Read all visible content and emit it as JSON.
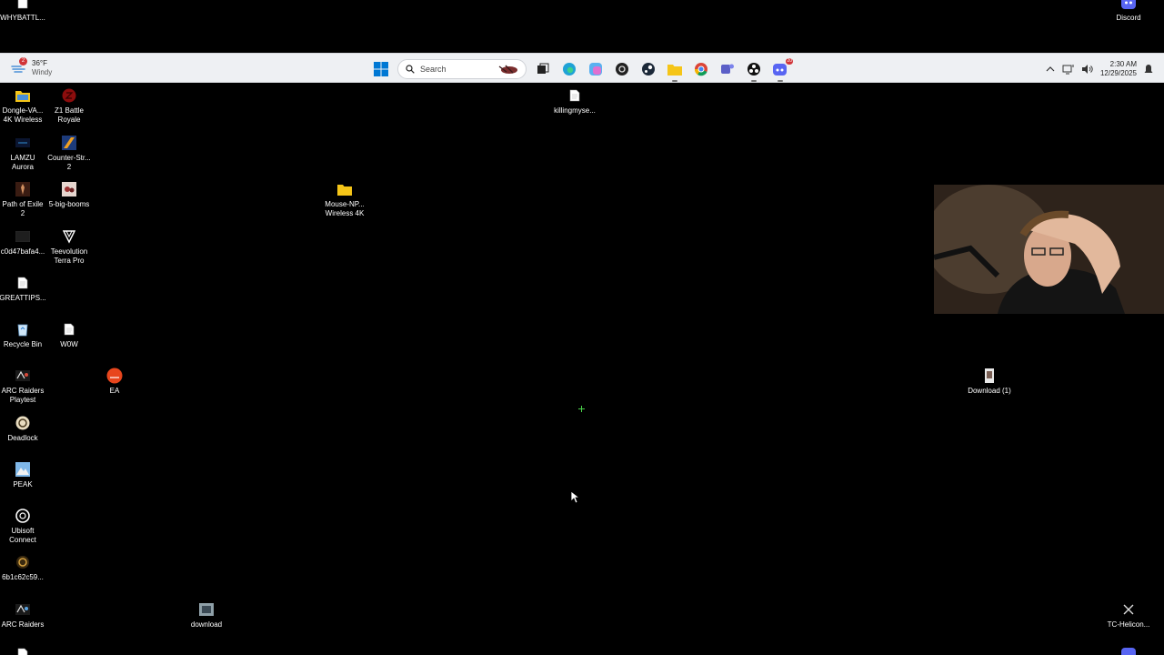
{
  "desktop": {
    "icons": [
      {
        "key": "whybattl",
        "label": "WHYBATTL..."
      },
      {
        "key": "discord_top",
        "label": "Discord"
      },
      {
        "key": "dongle",
        "label": "Dongle-VA...\n4K Wireless"
      },
      {
        "key": "z1",
        "label": "Z1 Battle\nRoyale"
      },
      {
        "key": "lamzu",
        "label": "LAMZU\nAurora"
      },
      {
        "key": "counterstrike",
        "label": "Counter-Str...\n2"
      },
      {
        "key": "poe",
        "label": "Path of Exile\n2"
      },
      {
        "key": "bigbooms",
        "label": "5-big-booms"
      },
      {
        "key": "c0d47",
        "label": "c0d47bafa4..."
      },
      {
        "key": "teevolution",
        "label": "Teevolution\nTerra Pro"
      },
      {
        "key": "greattips",
        "label": "GREATTIPS..."
      },
      {
        "key": "recyclebin",
        "label": "Recycle Bin"
      },
      {
        "key": "wow",
        "label": "W0W"
      },
      {
        "key": "arcplaytest",
        "label": "ARC Raiders\nPlaytest"
      },
      {
        "key": "ea",
        "label": "EA"
      },
      {
        "key": "deadlock",
        "label": "Deadlock"
      },
      {
        "key": "peak",
        "label": "PEAK"
      },
      {
        "key": "ubisoft",
        "label": "Ubisoft\nConnect"
      },
      {
        "key": "6b1c",
        "label": "6b1c62c59..."
      },
      {
        "key": "arcraiders",
        "label": "ARC Raiders"
      },
      {
        "key": "download",
        "label": "download"
      },
      {
        "key": "killing",
        "label": "killingmyse..."
      },
      {
        "key": "mousenp",
        "label": "Mouse-NP...\nWireless 4K"
      },
      {
        "key": "download1",
        "label": "Download (1)"
      },
      {
        "key": "tchelicon",
        "label": "TC-Helicon..."
      }
    ]
  },
  "taskbar": {
    "weather": {
      "temp": "36°F",
      "condition": "Windy",
      "badge": "2"
    },
    "search": {
      "placeholder": "Search"
    },
    "discord_badge": "20",
    "clock": {
      "time": "2:30 AM",
      "date": "12/29/2025"
    },
    "colors": {
      "background": "#eef0f3",
      "accent": "#0078d4"
    },
    "pinned_icons": [
      "start-icon",
      "search-icon",
      "task-view-icon",
      "edge-icon",
      "copilot-icon",
      "obs-icon",
      "steam-icon",
      "file-explorer-icon",
      "chrome-icon",
      "teams-icon",
      "obs-studio-icon",
      "discord-icon"
    ]
  }
}
